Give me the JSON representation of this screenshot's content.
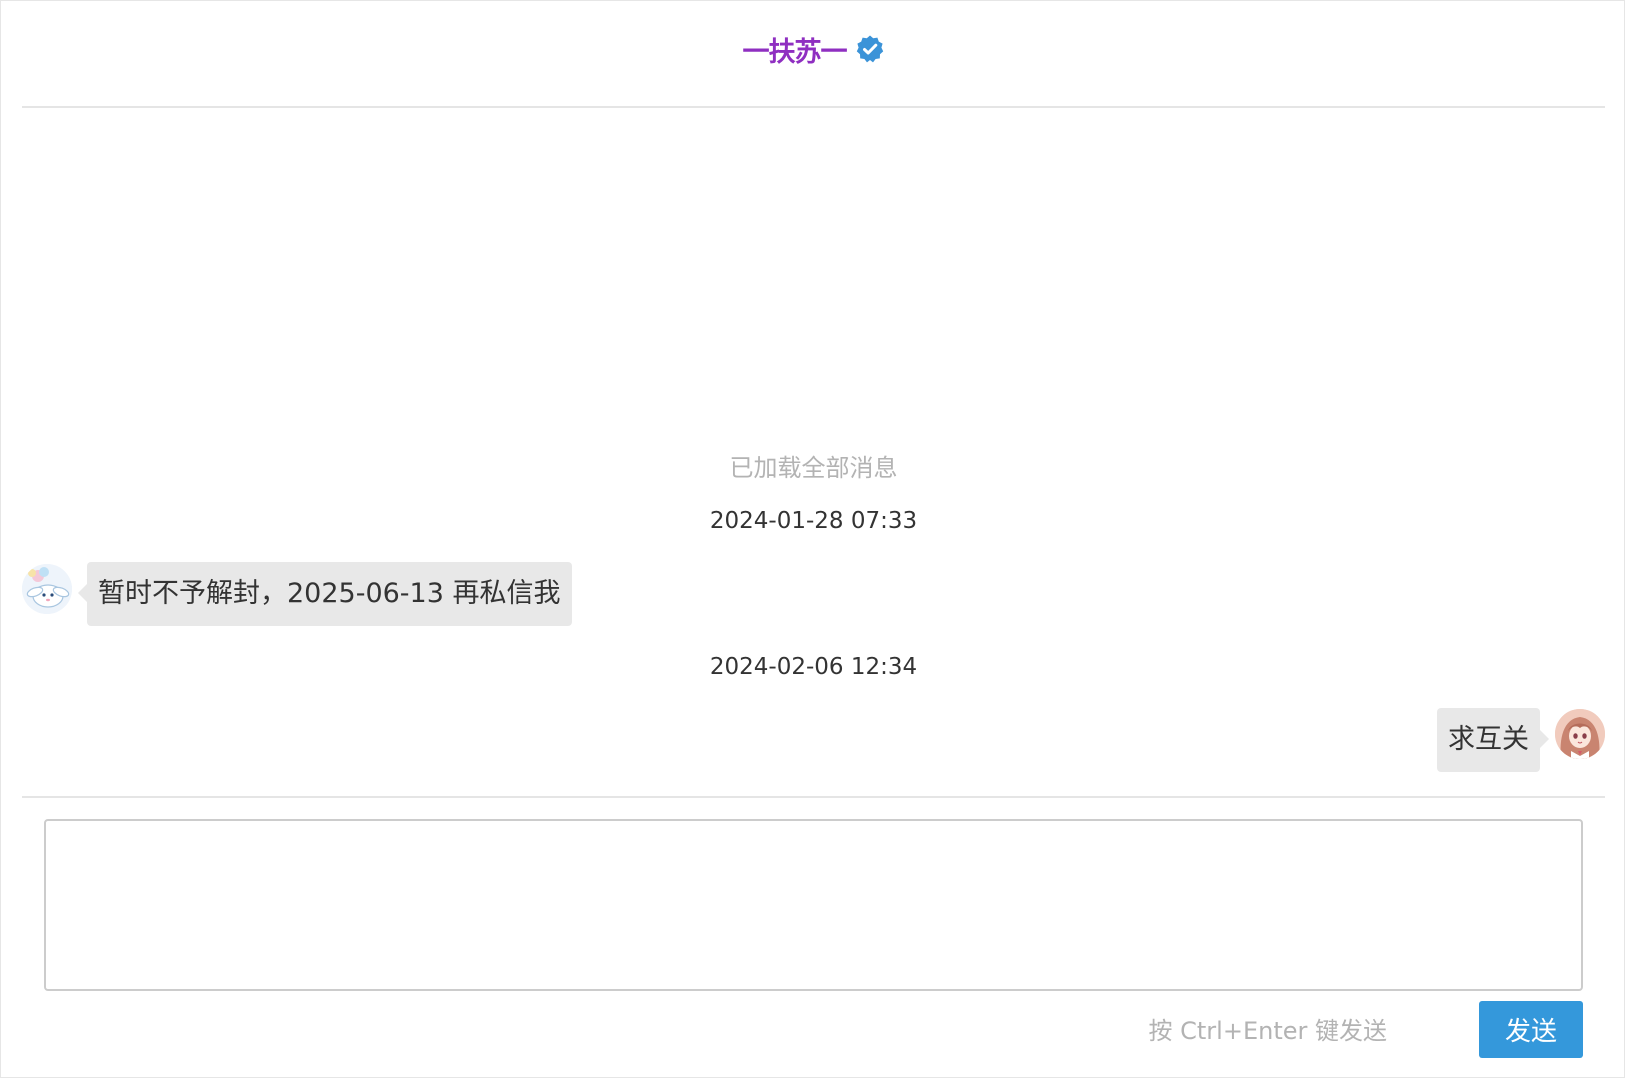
{
  "header": {
    "title": "一扶苏一",
    "verified_icon": "verified-badge-icon",
    "title_color": "#8f2fc1",
    "badge_color": "#3b93d8"
  },
  "chat": {
    "loaded_all_text": "已加载全部消息",
    "messages": [
      {
        "timestamp": "2024-01-28 07:33",
        "side": "left",
        "avatar_icon": "cartoon-bunny-avatar",
        "text": "暂时不予解封，2025-06-13 再私信我"
      },
      {
        "timestamp": "2024-02-06 12:34",
        "side": "right",
        "avatar_icon": "anime-girl-avatar",
        "text": "求互关"
      }
    ]
  },
  "composer": {
    "value": "",
    "placeholder": "",
    "hint": "按 Ctrl+Enter 键发送",
    "send_label": "发送",
    "send_color": "#3498db"
  }
}
